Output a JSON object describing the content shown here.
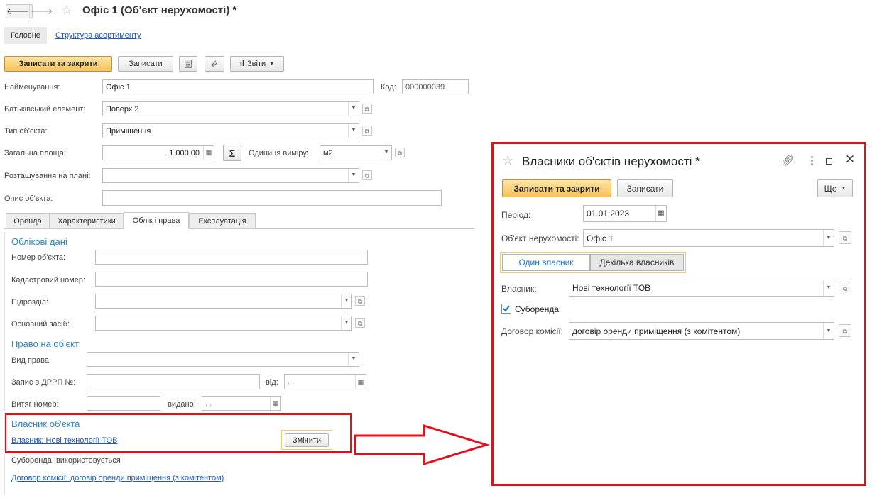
{
  "window": {
    "nav_back": "🡐",
    "nav_forward": "🡒",
    "title": "Офіс 1 (Об'єкт нерухомості) *"
  },
  "sections_nav": {
    "main": "Головне",
    "assortment": "Структура асортименту"
  },
  "toolbar": {
    "save_close": "Записати та закрити",
    "save": "Записати",
    "reports": "Звіти"
  },
  "form": {
    "name_label": "Найменування:",
    "name_value": "Офіс 1",
    "code_label": "Код:",
    "code_value": "000000039",
    "parent_label": "Батьківський елемент:",
    "parent_value": "Поверх 2",
    "type_label": "Тип об'єкта:",
    "type_value": "Приміщення",
    "area_label": "Загальна площа:",
    "area_value": "1 000,00",
    "unit_label": "Одиниця виміру:",
    "unit_value": "м2",
    "plan_label": "Розташування на плані:",
    "desc_label": "Опис об'єкта:"
  },
  "tabs": [
    "Оренда",
    "Характеристики",
    "Облік і права",
    "Експлуатація"
  ],
  "accounting": {
    "title": "Облікові дані",
    "number_label": "Номер об'єкта:",
    "cadastral_label": "Кадастровий номер:",
    "department_label": "Підрозділ:",
    "asset_label": "Основний засіб:"
  },
  "rights": {
    "title": "Право на об'єкт",
    "kind_label": "Вид права:",
    "record_label": "Запис в ДРРП №:",
    "from_label": "від:",
    "date_placeholder": ".  .",
    "extract_label": "Витяг номер:",
    "issued_label": "видано:"
  },
  "owner": {
    "title": "Власник об'єкта",
    "owner_link": "Власник: Нові технології ТОВ",
    "change_button": "Змінити",
    "sublease_text": "Суборенда: використовується",
    "contract_link": "Договор комісії: договір оренди приміщення (з комітентом)"
  },
  "dialog": {
    "title": "Власники об'єктів нерухомості *",
    "save_close": "Записати та закрити",
    "save": "Записати",
    "more": "Ще",
    "period_label": "Період:",
    "period_value": "01.01.2023",
    "object_label": "Об'єкт нерухомості:",
    "object_value": "Офіс 1",
    "mode_single": "Один власник",
    "mode_multiple": "Декілька власників",
    "owner_label": "Власник:",
    "owner_value": "Нові технології ТОВ",
    "sublease_label": "Суборенда",
    "sublease_checked": true,
    "contract_label": "Договор комісії:",
    "contract_value": "договір оренди приміщення (з комітентом)"
  },
  "colors": {
    "accent_red": "#e0101c",
    "primary_button": "#f4c25a",
    "link": "#1a57c8",
    "section": "#2b86c8"
  }
}
